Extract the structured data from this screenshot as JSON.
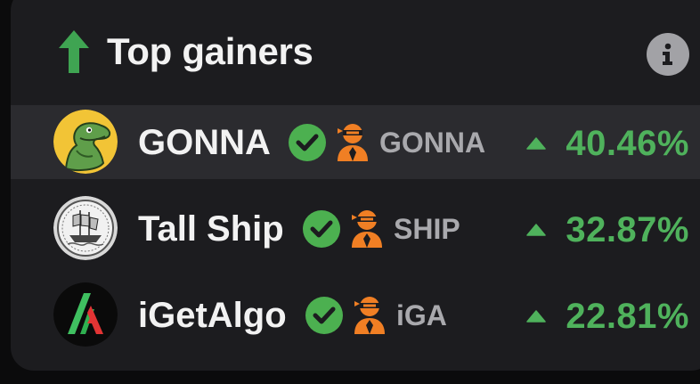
{
  "header": {
    "title": "Top gainers",
    "arrow_icon": "arrow-up-icon",
    "info_icon": "info-icon"
  },
  "colors": {
    "panel_bg": "#1c1c1f",
    "row_highlight": "#2b2b2f",
    "gain_green": "#4fb25c",
    "verified_green": "#4cb050",
    "ninja_orange": "#f07f24"
  },
  "gainers": [
    {
      "name": "GONNA",
      "symbol": "GONNA",
      "change": "40.46%",
      "verified": true,
      "highlighted": true
    },
    {
      "name": "Tall Ship",
      "symbol": "SHIP",
      "change": "32.87%",
      "verified": true,
      "highlighted": false
    },
    {
      "name": "iGetAlgo",
      "symbol": "iGA",
      "change": "22.81%",
      "verified": true,
      "highlighted": false
    }
  ]
}
